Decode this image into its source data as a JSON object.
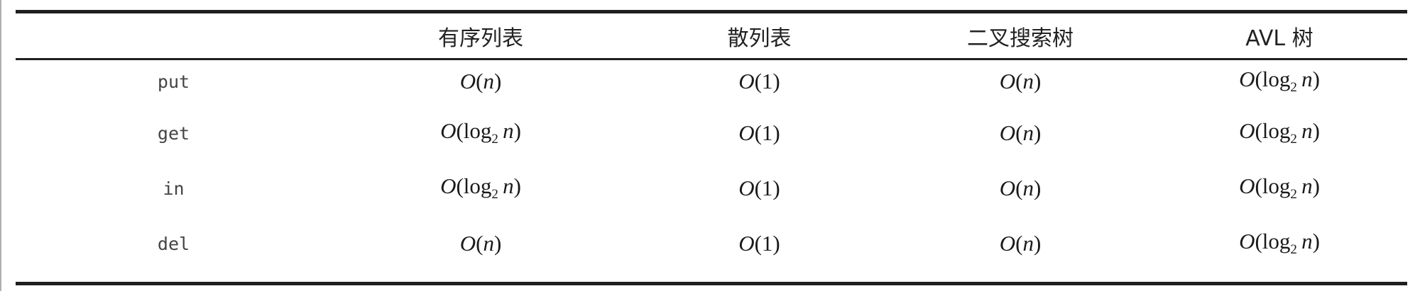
{
  "header": {
    "empty": "",
    "col1": "有序列表",
    "col2": "散列表",
    "col3": "二叉搜索树",
    "col4": "AVL 树"
  },
  "rows": [
    {
      "op": "put",
      "c1": "O(n)",
      "c2": "O(1)",
      "c3": "O(n)",
      "c4": "O(log₂ n)"
    },
    {
      "op": "get",
      "c1": "O(log₂ n)",
      "c2": "O(1)",
      "c3": "O(n)",
      "c4": "O(log₂ n)"
    },
    {
      "op": "in",
      "c1": "O(log₂ n)",
      "c2": "O(1)",
      "c3": "O(n)",
      "c4": "O(log₂ n)"
    },
    {
      "op": "del",
      "c1": "O(n)",
      "c2": "O(1)",
      "c3": "O(n)",
      "c4": "O(log₂ n)"
    }
  ]
}
